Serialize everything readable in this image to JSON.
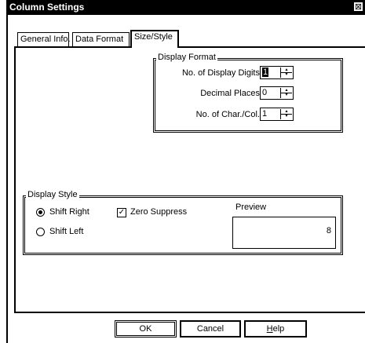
{
  "window": {
    "title": "Column Settings",
    "close_glyph": "⊠"
  },
  "tabs": [
    {
      "label": "General Info.",
      "active": false
    },
    {
      "label": "Data Format",
      "active": false
    },
    {
      "label": "Size/Style",
      "active": true
    }
  ],
  "display_format": {
    "legend": "Display Format",
    "fields": [
      {
        "label": "No. of Display Digits",
        "value": "1",
        "selected": true
      },
      {
        "label": "Decimal Places",
        "value": "0",
        "selected": false
      },
      {
        "label": "No. of Char./Col.",
        "value": "1",
        "selected": false
      }
    ]
  },
  "display_style": {
    "legend": "Display Style",
    "options": [
      {
        "label": "Shift Right",
        "checked": true
      },
      {
        "label": "Shift Left",
        "checked": false
      }
    ],
    "zero_suppress": {
      "label": "Zero Suppress",
      "checked": true
    },
    "preview": {
      "label": "Preview",
      "value": "8"
    }
  },
  "buttons": {
    "ok": "OK",
    "cancel": "Cancel",
    "help_first": "H",
    "help_rest": "elp"
  }
}
